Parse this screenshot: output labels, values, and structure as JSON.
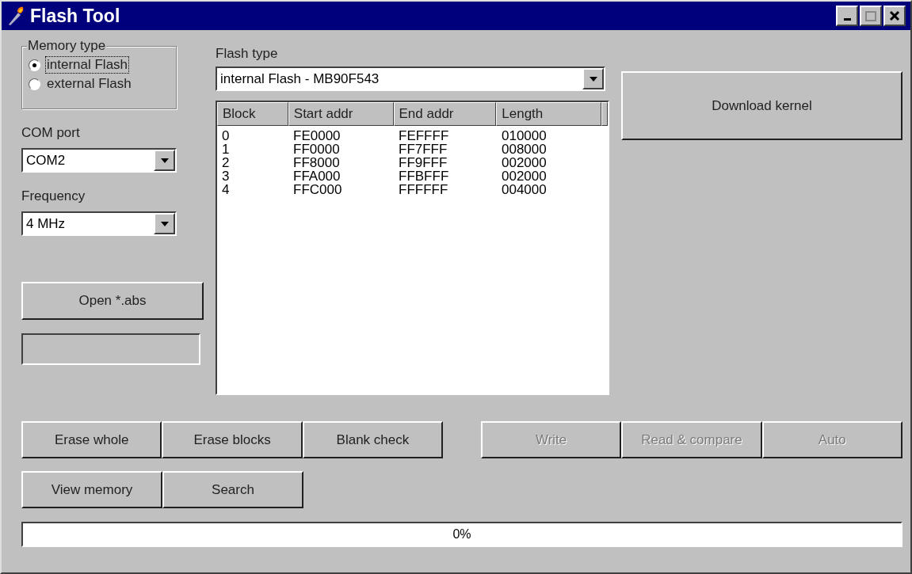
{
  "window": {
    "title": "Flash Tool"
  },
  "memory_type": {
    "label": "Memory type",
    "options": [
      {
        "label": "internal Flash",
        "selected": true,
        "focused": true
      },
      {
        "label": "external Flash",
        "selected": false,
        "focused": false
      }
    ]
  },
  "com_port": {
    "label": "COM port",
    "value": "COM2"
  },
  "frequency": {
    "label": "Frequency",
    "value": "4 MHz"
  },
  "open_button": {
    "label": "Open *.abs"
  },
  "flash_type": {
    "label": "Flash type",
    "value": "internal Flash - MB90F543"
  },
  "table": {
    "columns": [
      "Block",
      "Start addr",
      "End addr",
      "Length"
    ],
    "rows": [
      [
        "0",
        "FE0000",
        "FEFFFF",
        "010000"
      ],
      [
        "1",
        "FF0000",
        "FF7FFF",
        "008000"
      ],
      [
        "2",
        "FF8000",
        "FF9FFF",
        "002000"
      ],
      [
        "3",
        "FFA000",
        "FFBFFF",
        "002000"
      ],
      [
        "4",
        "FFC000",
        "FFFFFF",
        "004000"
      ]
    ]
  },
  "download_button": {
    "label": "Download kernel"
  },
  "action_buttons": [
    {
      "label": "Erase whole",
      "disabled": false
    },
    {
      "label": "Erase blocks",
      "disabled": false
    },
    {
      "label": "Blank check",
      "disabled": false
    },
    {
      "label": "Write",
      "disabled": true
    },
    {
      "label": "Read & compare",
      "disabled": true
    },
    {
      "label": "Auto",
      "disabled": true
    }
  ],
  "extra_buttons": [
    {
      "label": "View memory",
      "disabled": false
    },
    {
      "label": "Search",
      "disabled": false
    }
  ],
  "progress": {
    "level": 0,
    "reading": "0%"
  }
}
